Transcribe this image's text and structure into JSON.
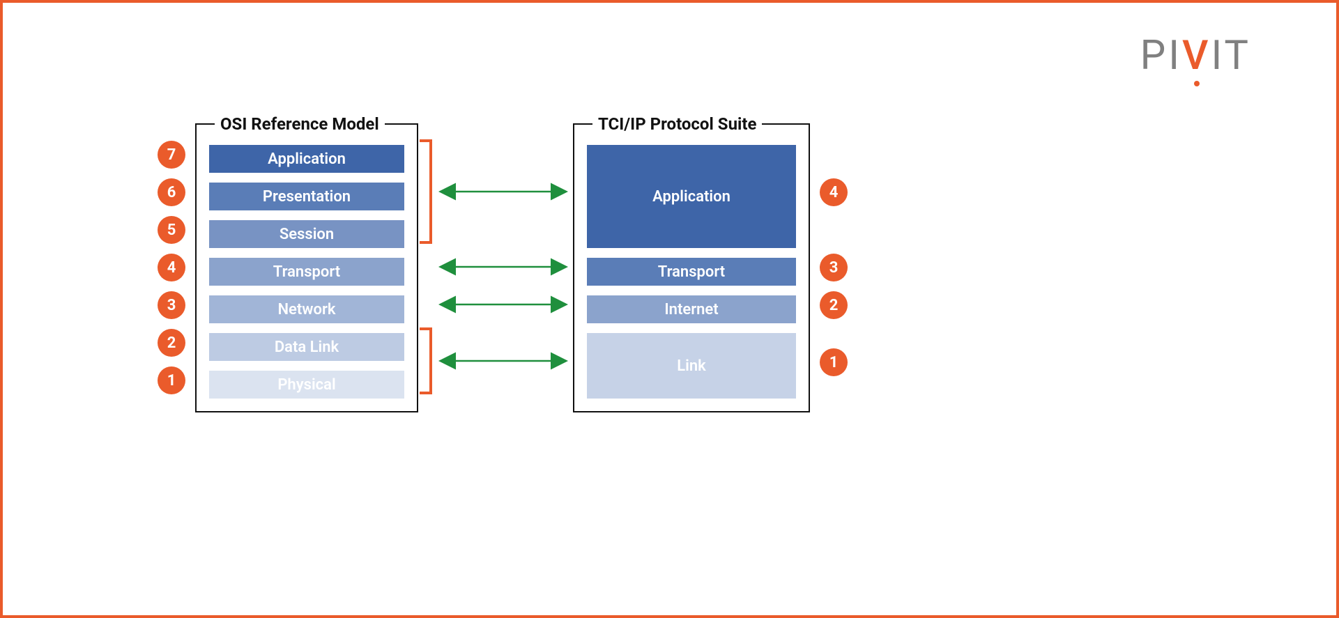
{
  "logo": {
    "prefix": "PI",
    "accent": "V",
    "suffix": "IT"
  },
  "osi": {
    "title": "OSI Reference Model",
    "layers": [
      {
        "num": "7",
        "label": "Application",
        "color": "#3e65a8"
      },
      {
        "num": "6",
        "label": "Presentation",
        "color": "#5a7db7"
      },
      {
        "num": "5",
        "label": "Session",
        "color": "#7893c3"
      },
      {
        "num": "4",
        "label": "Transport",
        "color": "#8ba3cc"
      },
      {
        "num": "3",
        "label": "Network",
        "color": "#a1b5d7"
      },
      {
        "num": "2",
        "label": "Data Link",
        "color": "#bdcbe3"
      },
      {
        "num": "1",
        "label": "Physical",
        "color": "#dbe3f0"
      }
    ]
  },
  "tcp": {
    "title": "TCI/IP Protocol Suite",
    "layers": [
      {
        "num": "4",
        "label": "Application",
        "color": "#3e65a8",
        "span": 3
      },
      {
        "num": "3",
        "label": "Transport",
        "color": "#5a7db7",
        "span": 1
      },
      {
        "num": "2",
        "label": "Internet",
        "color": "#8ba3cc",
        "span": 1
      },
      {
        "num": "1",
        "label": "Link",
        "color": "#c6d2e7",
        "span": 2
      }
    ]
  },
  "mappings": [
    {
      "osi_layers": [
        7,
        6,
        5
      ],
      "tcp_layer": 4
    },
    {
      "osi_layers": [
        4
      ],
      "tcp_layer": 3
    },
    {
      "osi_layers": [
        3
      ],
      "tcp_layer": 2
    },
    {
      "osi_layers": [
        2,
        1
      ],
      "tcp_layer": 1
    }
  ],
  "colors": {
    "accent": "#ea5b2b",
    "arrow": "#1f8f3d",
    "text_dark": "#111111",
    "logo_grey": "#808080"
  }
}
